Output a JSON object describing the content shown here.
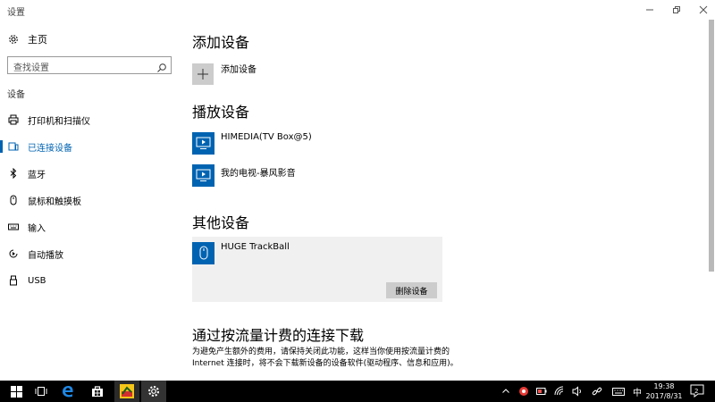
{
  "window": {
    "title": "设置"
  },
  "sidebar": {
    "home": "主页",
    "search_placeholder": "查找设置",
    "section": "设备",
    "items": [
      {
        "label": "打印机和扫描仪",
        "icon": "printer-icon"
      },
      {
        "label": "已连接设备",
        "icon": "connected-devices-icon"
      },
      {
        "label": "蓝牙",
        "icon": "bluetooth-icon"
      },
      {
        "label": "鼠标和触摸板",
        "icon": "mouse-icon"
      },
      {
        "label": "输入",
        "icon": "keyboard-icon"
      },
      {
        "label": "自动播放",
        "icon": "autoplay-icon"
      },
      {
        "label": "USB",
        "icon": "usb-icon"
      }
    ]
  },
  "main": {
    "add_section": {
      "title": "添加设备",
      "button_label": "添加设备"
    },
    "play_section": {
      "title": "播放设备",
      "devices": [
        {
          "name": "HIMEDIA(TV Box@5)",
          "icon": "display-icon"
        },
        {
          "name": "我的电视-暴风影音",
          "icon": "display-icon"
        }
      ]
    },
    "other_section": {
      "title": "其他设备",
      "device": {
        "name": "HUGE TrackBall",
        "icon": "mouse-icon"
      },
      "remove_label": "删除设备"
    },
    "metered_section": {
      "title": "通过按流量计费的连接下载",
      "description": "为避免产生额外的费用，请保持关闭此功能，这样当你使用按流量计费的 Internet 连接时，将不会下载新设备的设备软件(驱动程序、信息和应用)。"
    }
  },
  "taskbar": {
    "ime": "中",
    "time": "19:38",
    "date": "2017/8/31",
    "notification_count": "2"
  },
  "colors": {
    "accent": "#0063b1",
    "taskbar": "#000000"
  }
}
